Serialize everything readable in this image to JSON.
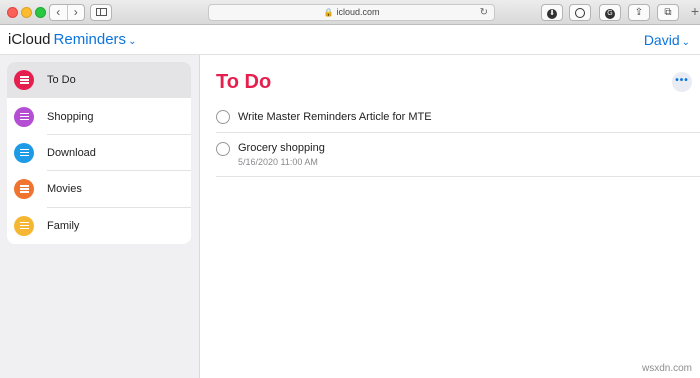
{
  "browser": {
    "url": "icloud.com",
    "nav_back": "‹",
    "nav_forward": "›",
    "new_tab": "+"
  },
  "header": {
    "brand": "iCloud",
    "app_name": "Reminders",
    "user_name": "David"
  },
  "sidebar": {
    "lists": [
      {
        "label": "To Do",
        "color": "#e6204e",
        "selected": true
      },
      {
        "label": "Shopping",
        "color": "#b44ed2"
      },
      {
        "label": "Download",
        "color": "#1e9be6"
      },
      {
        "label": "Movies",
        "color": "#f0742f"
      },
      {
        "label": "Family",
        "color": "#f5b731"
      }
    ]
  },
  "main": {
    "title": "To Do",
    "title_color": "#e6204e",
    "more_label": "•••",
    "reminders": [
      {
        "title": "Write Master Reminders Article for MTE",
        "meta": ""
      },
      {
        "title": "Grocery shopping",
        "meta": "5/16/2020 11:00 AM"
      }
    ]
  },
  "watermark": "wsxdn.com"
}
